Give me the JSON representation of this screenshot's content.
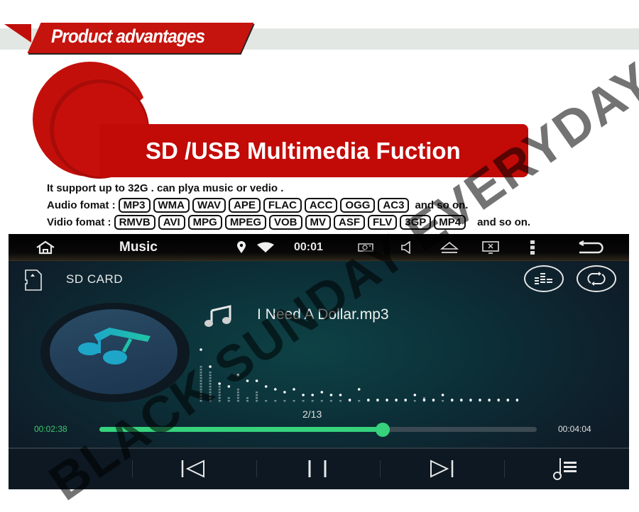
{
  "banner": {
    "section_title": "Product advantages",
    "feature_title": "SD /USB Multimedia Fuction",
    "colors": {
      "red": "#c20a07",
      "strip": "#e3e7e4"
    }
  },
  "specs": {
    "line1": "It support up to 32G . can plya music or vedio .",
    "audio_label": "Audio fomat :",
    "audio_formats": [
      "MP3",
      "WMA",
      "WAV",
      "APE",
      "FLAC",
      "ACC",
      "OGG",
      "AC3"
    ],
    "audio_tail": "and so on.",
    "video_label": "Vidio fomat :",
    "video_formats": [
      "RMVB",
      "AVI",
      "MPG",
      "MPEG",
      "VOB",
      "MV",
      "ASF",
      "FLV",
      "3GP",
      "MP4"
    ],
    "video_tail": "and so on."
  },
  "statusbar": {
    "title": "Music",
    "time": "00:01",
    "icons": [
      "home-icon",
      "location-icon",
      "wifi-icon",
      "screenshot-icon",
      "volume-icon",
      "eject-icon",
      "screen-off-icon",
      "more-icon",
      "back-icon"
    ]
  },
  "player": {
    "source_label": "SD CARD",
    "song_title": "I Need A Dollar.mp3",
    "track_position": "2/13",
    "current_time": "00:02:38",
    "total_time": "00:04:04",
    "progress_percent": 64.8,
    "accent_color": "#36d27c",
    "visualizer": {
      "bars": [
        12,
        10,
        5,
        1,
        4,
        1,
        3,
        0,
        0,
        0,
        0,
        0,
        0,
        0,
        0,
        0,
        0,
        0,
        0,
        0,
        0,
        0,
        0,
        0,
        1,
        0,
        0,
        0,
        0,
        0,
        0,
        0,
        0,
        0,
        0
      ],
      "peaks": [
        17,
        11,
        5,
        4,
        8,
        6,
        6,
        4,
        3,
        2,
        3,
        1,
        1,
        2,
        1,
        1,
        0,
        3,
        0,
        0,
        0,
        0,
        0,
        1,
        0,
        0,
        1,
        0,
        0,
        0,
        0,
        0,
        0,
        0,
        0
      ]
    },
    "controls": [
      "previous",
      "pause",
      "next",
      "playlist"
    ]
  },
  "watermark": "BLACK SUNDAY EVERYDAY"
}
